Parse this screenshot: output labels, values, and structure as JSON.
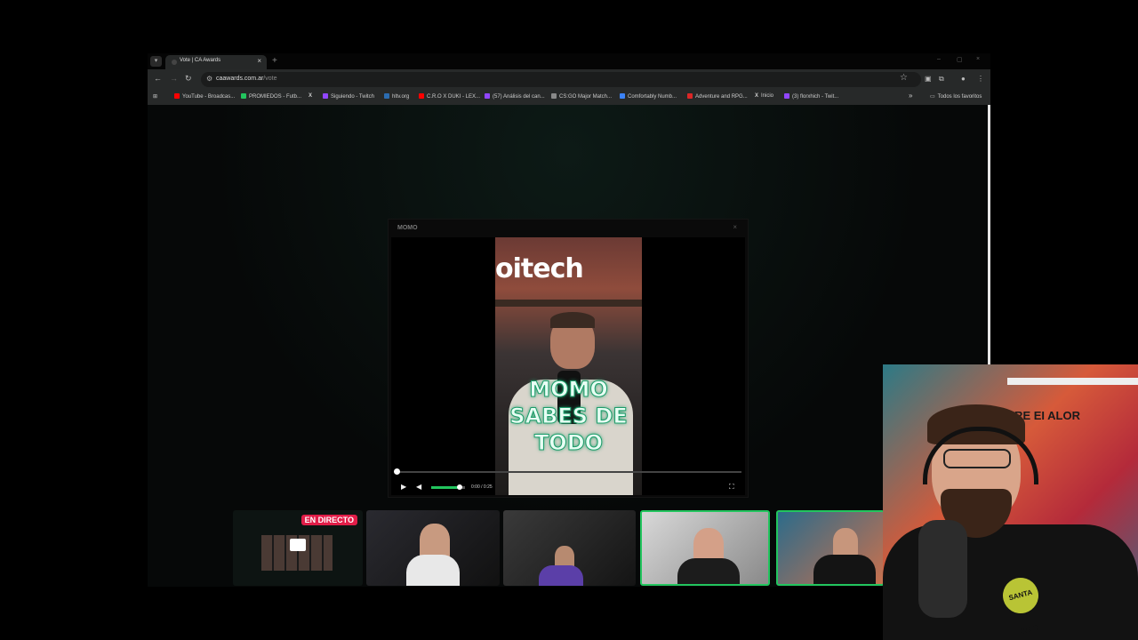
{
  "browser": {
    "tab": {
      "title": "Vote | CA Awards",
      "close": "×"
    },
    "new_tab": "+",
    "window_controls": [
      "–",
      "▢",
      "×"
    ],
    "url": {
      "domain": "caawards.com.ar",
      "path": "/vote"
    },
    "bookmarks": [
      {
        "label": "YouTube - Broadcas...",
        "color": "#ff0000"
      },
      {
        "label": "PROMIEDOS - Futb...",
        "color": "#22c55e"
      },
      {
        "label": "",
        "color": "#ffffff",
        "icon": "X"
      },
      {
        "label": "Siguiendo - Twitch",
        "color": "#9146ff"
      },
      {
        "label": "hltv.org",
        "color": "#2b6cb0"
      },
      {
        "label": "C.R.O X DUKI - LEX...",
        "color": "#ff0000"
      },
      {
        "label": "(57) Análisis del can...",
        "color": "#9146ff"
      },
      {
        "label": "CS:GO Major Match...",
        "color": "#888888"
      },
      {
        "label": "Comfortably Numb...",
        "color": "#3b82f6"
      },
      {
        "label": "Adventure and RPG...",
        "color": "#dc2626"
      },
      {
        "label": "Inicio",
        "color": "#ffffff",
        "icon": "X"
      },
      {
        "label": "(3) florxhich - Twit...",
        "color": "#9146ff"
      }
    ],
    "bookmarks_more": "»",
    "all_favorites": "Todos los favoritos"
  },
  "modal": {
    "title": "MOMO",
    "close": "×",
    "video": {
      "brand_text": "oitech",
      "caption": "MOMO SABES DE TODO",
      "progress": 0.0,
      "volume": 0.85,
      "time": "0:00 / 0:25"
    }
  },
  "live_strip": {
    "badge": "EN DIRECTO",
    "accent": "#22c55e"
  },
  "webcam": {
    "wall_text": "APRE EI ALOR",
    "shirt_logo": "SANTA CRUZ"
  }
}
